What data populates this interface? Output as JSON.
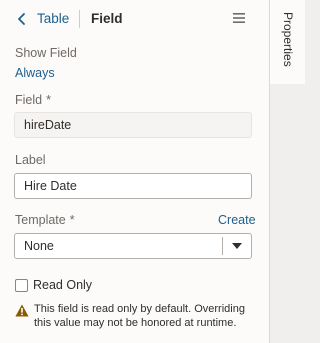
{
  "header": {
    "back_label": "Table",
    "title": "Field"
  },
  "show_field": {
    "label": "Show Field",
    "value": "Always"
  },
  "field": {
    "label": "Field",
    "required_mark": "*",
    "value": "hireDate"
  },
  "label_field": {
    "label": "Label",
    "value": "Hire Date"
  },
  "template": {
    "label": "Template",
    "required_mark": "*",
    "create_link": "Create",
    "selected": "None"
  },
  "read_only": {
    "label": "Read Only",
    "checked": false
  },
  "warning": {
    "text": "This field is read only by default. Overriding this value may not be honored at runtime."
  },
  "side_tab": {
    "label": "Properties"
  },
  "colors": {
    "link": "#1e5f8c",
    "warning": "#8a5a00",
    "panel_bg": "#fcfbfa",
    "strip_bg": "#f1efed"
  },
  "icons": {
    "back": "chevron-left-icon",
    "menu": "hamburger-menu-icon",
    "select": "caret-down-icon",
    "warning": "warning-triangle-icon"
  }
}
